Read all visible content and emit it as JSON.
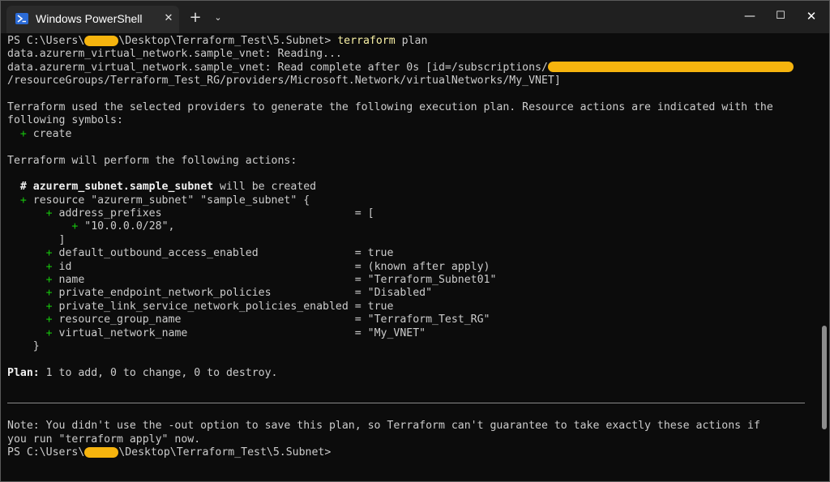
{
  "window": {
    "tab_title": "Windows PowerShell",
    "tab_close": "✕",
    "new_tab": "+",
    "dropdown": "⌄",
    "minimize": "—",
    "maximize": "☐",
    "close": "✕"
  },
  "terminal": {
    "l1_prompt_a": "PS C:\\Users\\",
    "l1_prompt_b": "\\Desktop\\Terraform_Test\\5.Subnet> ",
    "l1_cmd": "terraform",
    "l1_arg": " plan",
    "l2": "data.azurerm_virtual_network.sample_vnet: Reading...",
    "l3": "data.azurerm_virtual_network.sample_vnet: Read complete after 0s [id=/subscriptions/",
    "l4": "/resourceGroups/Terraform_Test_RG/providers/Microsoft.Network/virtualNetworks/My_VNET]",
    "l5": "",
    "l6": "Terraform used the selected providers to generate the following execution plan. Resource actions are indicated with the",
    "l7": "following symbols:",
    "l8_sym": "  + ",
    "l8_text": "create",
    "l9": "",
    "l10": "Terraform will perform the following actions:",
    "l11": "",
    "l12_hash": "  # ",
    "l12_res": "azurerm_subnet.sample_subnet",
    "l12_rest": " will be created",
    "l13_sym": "  + ",
    "l13_text": "resource \"azurerm_subnet\" \"sample_subnet\" {",
    "attrs": [
      {
        "indent": "      + ",
        "text": "address_prefixes                              = ["
      },
      {
        "indent": "          + ",
        "text": "\"10.0.0.0/28\","
      },
      {
        "indent": "        ",
        "text": "]"
      },
      {
        "indent": "      + ",
        "text": "default_outbound_access_enabled               = true"
      },
      {
        "indent": "      + ",
        "text": "id                                            = (known after apply)"
      },
      {
        "indent": "      + ",
        "text": "name                                          = \"Terraform_Subnet01\""
      },
      {
        "indent": "      + ",
        "text": "private_endpoint_network_policies             = \"Disabled\""
      },
      {
        "indent": "      + ",
        "text": "private_link_service_network_policies_enabled = true"
      },
      {
        "indent": "      + ",
        "text": "resource_group_name                           = \"Terraform_Test_RG\""
      },
      {
        "indent": "      + ",
        "text": "virtual_network_name                          = \"My_VNET\""
      }
    ],
    "close_brace": "    }",
    "plan_label": "Plan:",
    "plan_text": " 1 to add, 0 to change, 0 to destroy.",
    "note1": "Note: You didn't use the -out option to save this plan, so Terraform can't guarantee to take exactly these actions if",
    "note2": "you run \"terraform apply\" now.",
    "last_prompt_a": "PS C:\\Users\\",
    "last_prompt_b": "\\Desktop\\Terraform_Test\\5.Subnet>"
  },
  "colors": {
    "background": "#0c0c0c",
    "text": "#cccccc",
    "command": "#f9f1a5",
    "plus": "#16c60c",
    "redaction": "#f6b40e"
  },
  "icons": [
    "powershell-icon",
    "close-icon",
    "plus-icon",
    "chevron-down-icon",
    "minimize-icon",
    "maximize-icon",
    "close-window-icon"
  ]
}
